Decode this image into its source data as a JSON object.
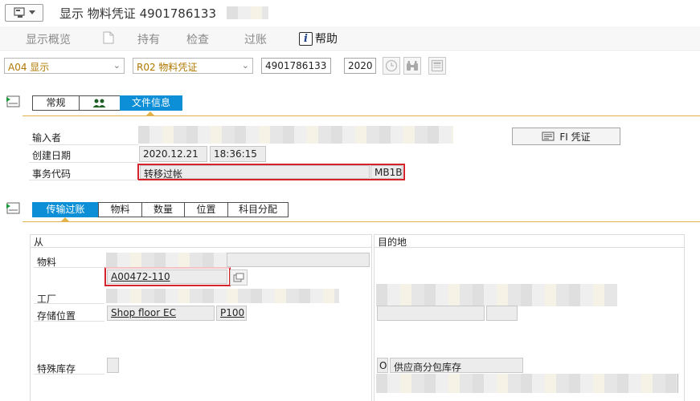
{
  "window": {
    "title_prefix": "显示 物料凭证",
    "doc_number": "4901786133"
  },
  "toolbar": {
    "overview": "显示概览",
    "hold": "持有",
    "check": "检查",
    "post": "过账",
    "help": "帮助",
    "help_glyph": "i"
  },
  "selection": {
    "action": "A04 显示",
    "ref_type": "R02 物料凭证",
    "doc_number": "4901786133",
    "year": "2020"
  },
  "header_tabs": {
    "general": "常规",
    "doc_info": "文件信息"
  },
  "header_fields": {
    "entered_by_label": "输入者",
    "created_label": "创建日期",
    "created_date": "2020.12.21",
    "created_time": "18:36:15",
    "txn_label": "事务代码",
    "txn_text": "转移过帐",
    "txn_code": "MB1B",
    "fi_button": "FI 凭证"
  },
  "item_tabs": {
    "transfer": "传输过账",
    "material": "物料",
    "quantity": "数量",
    "location": "位置",
    "account": "科目分配"
  },
  "from_panel": {
    "title": "从",
    "material_label": "物料",
    "material_number": "A00472-110",
    "plant_label": "工厂",
    "storage_label": "存储位置",
    "storage_desc": "Shop floor EC",
    "storage_code": "P100",
    "special_stock_label": "特殊库存"
  },
  "to_panel": {
    "title": "目的地",
    "special_code": "O",
    "special_desc": "供应商分包库存"
  },
  "colors": {
    "accent_tab": "#0c8fd6",
    "gold_line": "#e1b24a",
    "highlight_border": "#d5232c",
    "dropdown_text": "#b07800"
  }
}
